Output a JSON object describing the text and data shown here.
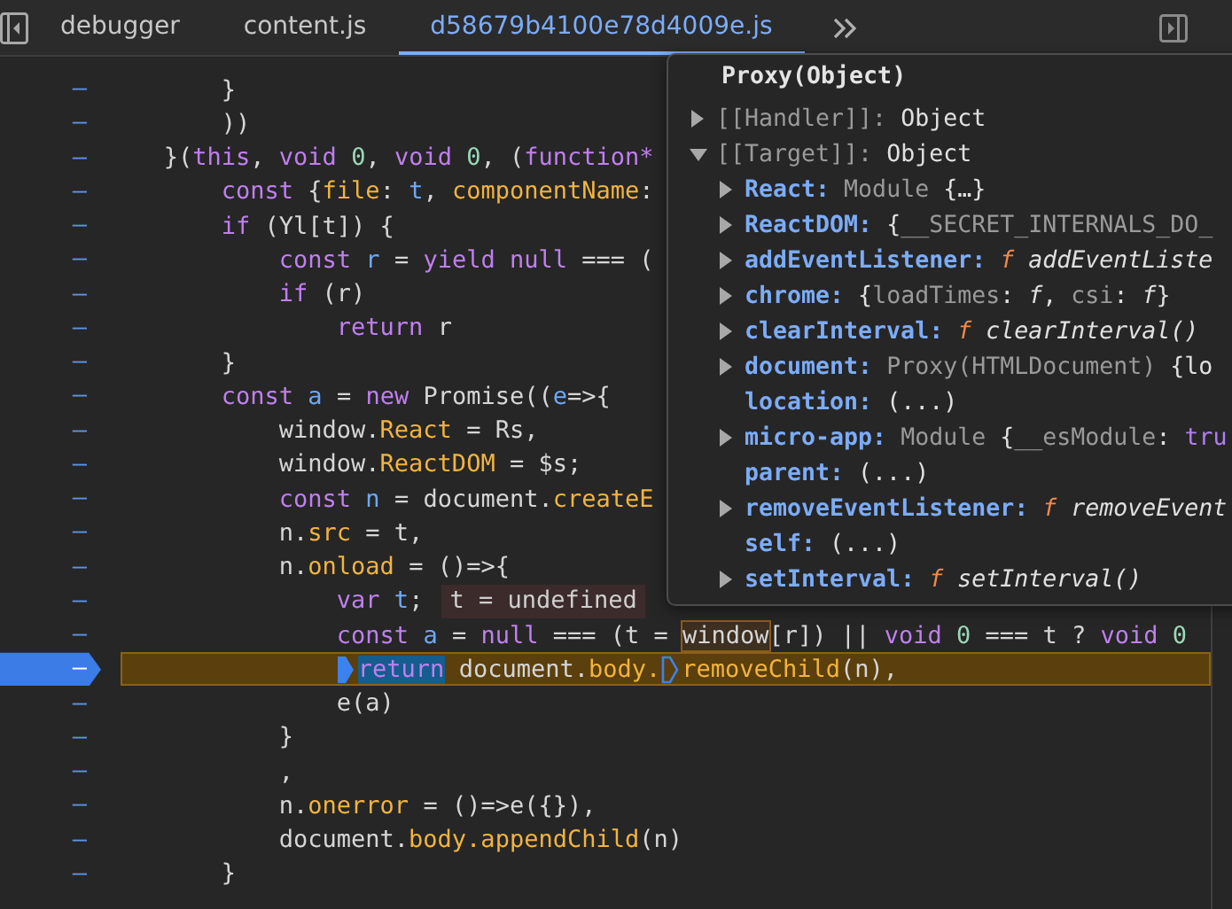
{
  "tabs": [
    {
      "label": "debugger",
      "selected": false
    },
    {
      "label": "content.js",
      "selected": false
    },
    {
      "label": "d58679b4100e78d4009e.js",
      "selected": true
    }
  ],
  "editor": {
    "lines": [
      {
        "number": "–",
        "paused": false,
        "tokens": [
          {
            "kind": "plain",
            "text": "       }"
          }
        ]
      },
      {
        "number": "–",
        "paused": false,
        "tokens": [
          {
            "kind": "plain",
            "text": "       ))"
          }
        ]
      },
      {
        "number": "–",
        "paused": false,
        "tokens": [
          {
            "kind": "plain",
            "text": "   }("
          },
          {
            "kind": "kw",
            "text": "this"
          },
          {
            "kind": "plain",
            "text": ", "
          },
          {
            "kind": "kw",
            "text": "void "
          },
          {
            "kind": "num",
            "text": "0"
          },
          {
            "kind": "plain",
            "text": ", "
          },
          {
            "kind": "kw",
            "text": "void "
          },
          {
            "kind": "num",
            "text": "0"
          },
          {
            "kind": "plain",
            "text": ", ("
          },
          {
            "kind": "kw",
            "text": "function*"
          }
        ]
      },
      {
        "number": "–",
        "paused": false,
        "tokens": [
          {
            "kind": "kw",
            "text": "       const"
          },
          {
            "kind": "plain",
            "text": " {"
          },
          {
            "kind": "prop",
            "text": "file"
          },
          {
            "kind": "plain",
            "text": ": "
          },
          {
            "kind": "var",
            "text": "t"
          },
          {
            "kind": "plain",
            "text": ", "
          },
          {
            "kind": "prop",
            "text": "componentName"
          },
          {
            "kind": "plain",
            "text": ":"
          }
        ]
      },
      {
        "number": "–",
        "paused": false,
        "tokens": [
          {
            "kind": "kw",
            "text": "       if"
          },
          {
            "kind": "plain",
            "text": " (Yl[t]) {"
          }
        ]
      },
      {
        "number": "–",
        "paused": false,
        "tokens": [
          {
            "kind": "kw",
            "text": "           const "
          },
          {
            "kind": "var",
            "text": "r"
          },
          {
            "kind": "plain",
            "text": " = "
          },
          {
            "kind": "kw",
            "text": "yield null"
          },
          {
            "kind": "plain",
            "text": " === ("
          }
        ]
      },
      {
        "number": "–",
        "paused": false,
        "tokens": [
          {
            "kind": "kw",
            "text": "           if"
          },
          {
            "kind": "plain",
            "text": " (r)"
          }
        ]
      },
      {
        "number": "–",
        "paused": false,
        "tokens": [
          {
            "kind": "kw",
            "text": "               return"
          },
          {
            "kind": "plain",
            "text": " r"
          }
        ]
      },
      {
        "number": "–",
        "paused": false,
        "tokens": [
          {
            "kind": "plain",
            "text": "       }"
          }
        ]
      },
      {
        "number": "–",
        "paused": false,
        "tokens": [
          {
            "kind": "kw",
            "text": "       const "
          },
          {
            "kind": "var",
            "text": "a"
          },
          {
            "kind": "plain",
            "text": " = "
          },
          {
            "kind": "kw",
            "text": "new"
          },
          {
            "kind": "plain",
            "text": " Promise(("
          },
          {
            "kind": "var",
            "text": "e"
          },
          {
            "kind": "plain",
            "text": "=>{"
          }
        ]
      },
      {
        "number": "–",
        "paused": false,
        "tokens": [
          {
            "kind": "plain",
            "text": "           window."
          },
          {
            "kind": "prop",
            "text": "React"
          },
          {
            "kind": "plain",
            "text": " = Rs,"
          }
        ]
      },
      {
        "number": "–",
        "paused": false,
        "tokens": [
          {
            "kind": "plain",
            "text": "           window."
          },
          {
            "kind": "prop",
            "text": "ReactDOM"
          },
          {
            "kind": "plain",
            "text": " = $s;"
          }
        ]
      },
      {
        "number": "–",
        "paused": false,
        "tokens": [
          {
            "kind": "kw",
            "text": "           const "
          },
          {
            "kind": "var",
            "text": "n"
          },
          {
            "kind": "plain",
            "text": " = document."
          },
          {
            "kind": "prop",
            "text": "createE"
          }
        ]
      },
      {
        "number": "–",
        "paused": false,
        "tokens": [
          {
            "kind": "plain",
            "text": "           n."
          },
          {
            "kind": "prop",
            "text": "src"
          },
          {
            "kind": "plain",
            "text": " = t,"
          }
        ]
      },
      {
        "number": "–",
        "paused": false,
        "tokens": [
          {
            "kind": "plain",
            "text": "           n."
          },
          {
            "kind": "prop",
            "text": "onload"
          },
          {
            "kind": "plain",
            "text": " = ()=>{"
          }
        ]
      },
      {
        "number": "–",
        "paused": false,
        "tokens": [
          {
            "kind": "kw",
            "text": "               var "
          },
          {
            "kind": "var",
            "text": "t"
          },
          {
            "kind": "plain",
            "text": ";"
          },
          {
            "kind": "inline_value",
            "text": "t = undefined"
          }
        ]
      },
      {
        "number": "–",
        "paused": false,
        "tokens": [
          {
            "kind": "kw",
            "text": "               const "
          },
          {
            "kind": "var",
            "text": "a"
          },
          {
            "kind": "plain",
            "text": " = "
          },
          {
            "kind": "kw",
            "text": "null"
          },
          {
            "kind": "plain",
            "text": " === (t = "
          },
          {
            "kind": "hovered",
            "text": "window"
          },
          {
            "kind": "plain",
            "text": "[r]) || "
          },
          {
            "kind": "kw",
            "text": "void "
          },
          {
            "kind": "num",
            "text": "0"
          },
          {
            "kind": "plain",
            "text": " === t ? "
          },
          {
            "kind": "kw",
            "text": "void "
          },
          {
            "kind": "num",
            "text": "0"
          }
        ]
      },
      {
        "number": "–",
        "paused": true,
        "tokens": [
          {
            "kind": "marker_current"
          },
          {
            "kind": "kw_current",
            "text": "               return"
          },
          {
            "kind": "plain",
            "text": " document."
          },
          {
            "kind": "prop",
            "text": "body."
          },
          {
            "kind": "marker_step"
          },
          {
            "kind": "prop",
            "text": "removeChild"
          },
          {
            "kind": "plain",
            "text": "(n),"
          }
        ]
      },
      {
        "number": "–",
        "paused": false,
        "tokens": [
          {
            "kind": "plain",
            "text": "               e(a)"
          }
        ]
      },
      {
        "number": "–",
        "paused": false,
        "tokens": [
          {
            "kind": "plain",
            "text": "           }"
          }
        ]
      },
      {
        "number": "–",
        "paused": false,
        "tokens": [
          {
            "kind": "plain",
            "text": "           ,"
          }
        ]
      },
      {
        "number": "–",
        "paused": false,
        "tokens": [
          {
            "kind": "plain",
            "text": "           n."
          },
          {
            "kind": "prop",
            "text": "onerror"
          },
          {
            "kind": "plain",
            "text": " = ()=>e({}),"
          }
        ]
      },
      {
        "number": "–",
        "paused": false,
        "tokens": [
          {
            "kind": "plain",
            "text": "           document."
          },
          {
            "kind": "prop",
            "text": "body.appendChild"
          },
          {
            "kind": "plain",
            "text": "(n)"
          }
        ]
      },
      {
        "number": "–",
        "paused": false,
        "tokens": [
          {
            "kind": "plain",
            "text": "       }"
          }
        ]
      }
    ]
  },
  "popover": {
    "title": "Proxy(Object)",
    "rows": [
      {
        "key": "[[Handler]]:",
        "internal": true,
        "expandable": true,
        "expanded": false,
        "value": [
          {
            "kind": "plain",
            "text": "Object"
          }
        ]
      },
      {
        "key": "[[Target]]:",
        "internal": true,
        "expandable": true,
        "expanded": true,
        "value": [
          {
            "kind": "plain",
            "text": "Object"
          }
        ],
        "children": [
          {
            "key": "React:",
            "internal": false,
            "expandable": true,
            "expanded": false,
            "value": [
              {
                "kind": "dim",
                "text": "Module "
              },
              {
                "kind": "plain",
                "text": "{…}"
              }
            ]
          },
          {
            "key": "ReactDOM:",
            "internal": false,
            "expandable": true,
            "expanded": false,
            "value": [
              {
                "kind": "plain",
                "text": "{"
              },
              {
                "kind": "dim",
                "text": "__SECRET_INTERNALS_DO_"
              }
            ]
          },
          {
            "key": "addEventListener:",
            "internal": false,
            "expandable": true,
            "expanded": false,
            "value": [
              {
                "kind": "fn",
                "text": "f "
              },
              {
                "kind": "italic",
                "text": "addEventListe"
              }
            ]
          },
          {
            "key": "chrome:",
            "internal": false,
            "expandable": true,
            "expanded": false,
            "value": [
              {
                "kind": "plain",
                "text": "{"
              },
              {
                "kind": "dim",
                "text": "loadTimes"
              },
              {
                "kind": "plain",
                "text": ": "
              },
              {
                "kind": "italic",
                "text": "f"
              },
              {
                "kind": "plain",
                "text": ", "
              },
              {
                "kind": "dim",
                "text": "csi"
              },
              {
                "kind": "plain",
                "text": ": "
              },
              {
                "kind": "italic",
                "text": "f"
              },
              {
                "kind": "plain",
                "text": "}"
              }
            ]
          },
          {
            "key": "clearInterval:",
            "internal": false,
            "expandable": true,
            "expanded": false,
            "value": [
              {
                "kind": "fn",
                "text": "f "
              },
              {
                "kind": "italic",
                "text": "clearInterval()"
              }
            ]
          },
          {
            "key": "document:",
            "internal": false,
            "expandable": true,
            "expanded": false,
            "value": [
              {
                "kind": "dim",
                "text": "Proxy(HTMLDocument) "
              },
              {
                "kind": "plain",
                "text": "{lo"
              }
            ]
          },
          {
            "key": "location:",
            "internal": false,
            "expandable": false,
            "value": [
              {
                "kind": "plain",
                "text": "(...)"
              }
            ]
          },
          {
            "key": "micro-app:",
            "internal": false,
            "expandable": true,
            "expanded": false,
            "value": [
              {
                "kind": "dim",
                "text": "Module "
              },
              {
                "kind": "plain",
                "text": "{"
              },
              {
                "kind": "dim",
                "text": "__esModule"
              },
              {
                "kind": "plain",
                "text": ": "
              },
              {
                "kind": "bool",
                "text": "tru"
              }
            ]
          },
          {
            "key": "parent:",
            "internal": false,
            "expandable": false,
            "value": [
              {
                "kind": "plain",
                "text": "(...)"
              }
            ]
          },
          {
            "key": "removeEventListener:",
            "internal": false,
            "expandable": true,
            "expanded": false,
            "value": [
              {
                "kind": "fn",
                "text": "f "
              },
              {
                "kind": "italic",
                "text": "removeEvent"
              }
            ]
          },
          {
            "key": "self:",
            "internal": false,
            "expandable": false,
            "value": [
              {
                "kind": "plain",
                "text": "(...)"
              }
            ]
          },
          {
            "key": "setInterval:",
            "internal": false,
            "expandable": true,
            "expanded": false,
            "value": [
              {
                "kind": "fn",
                "text": "f "
              },
              {
                "kind": "italic",
                "text": "setInterval()"
              }
            ]
          }
        ]
      }
    ]
  }
}
